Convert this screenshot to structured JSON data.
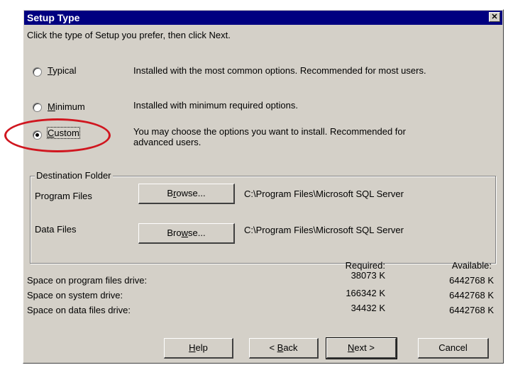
{
  "dialog": {
    "title": "Setup Type",
    "close_glyph": "✕",
    "instruction": "Click the type of Setup you prefer, then click Next."
  },
  "options": [
    {
      "label_pre": "",
      "label_ul": "T",
      "label_post": "ypical",
      "description": "Installed with the most common options. Recommended for most users.",
      "selected": false
    },
    {
      "label_pre": "",
      "label_ul": "M",
      "label_post": "inimum",
      "description": "Installed with minimum required options.",
      "selected": false
    },
    {
      "label_pre": "",
      "label_ul": "C",
      "label_post": "ustom",
      "description": "You may choose the options you want to install. Recommended for",
      "description2": "advanced users.",
      "selected": true
    }
  ],
  "destination": {
    "legend": "Destination Folder",
    "program_label": "Program Files",
    "program_browse_pre": "B",
    "program_browse_ul": "r",
    "program_browse_post": "owse...",
    "program_path": "C:\\Program Files\\Microsoft SQL Server",
    "data_label": "Data Files",
    "data_browse_pre": "Bro",
    "data_browse_ul": "w",
    "data_browse_post": "se...",
    "data_path": "C:\\Program Files\\Microsoft SQL Server"
  },
  "space": {
    "required_header": "Required:",
    "available_header": "Available:",
    "rows": [
      {
        "label": "Space on program files drive:",
        "required": "38073 K",
        "available": "6442768 K"
      },
      {
        "label": "Space on system drive:",
        "required": "166342 K",
        "available": "6442768 K"
      },
      {
        "label": "Space on data files drive:",
        "required": "34432 K",
        "available": "6442768 K"
      }
    ]
  },
  "buttons": {
    "help_ul": "H",
    "help_post": "elp",
    "back_pre": "< ",
    "back_ul": "B",
    "back_post": "ack",
    "next_ul": "N",
    "next_post": "ext >",
    "cancel": "Cancel"
  },
  "colors": {
    "title_bar": "#000080",
    "dialog_face": "#d4d0c8",
    "annotation": "#d0161f"
  }
}
